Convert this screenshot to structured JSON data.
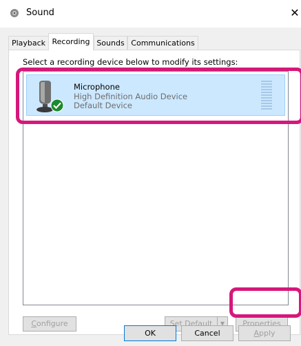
{
  "window": {
    "title": "Sound",
    "close_glyph": "✕"
  },
  "tabs": [
    {
      "label": "Playback",
      "active": false
    },
    {
      "label": "Recording",
      "active": true
    },
    {
      "label": "Sounds",
      "active": false
    },
    {
      "label": "Communications",
      "active": false
    }
  ],
  "recording": {
    "instruction": "Select a recording device below to modify its settings:",
    "devices": [
      {
        "name": "Microphone",
        "description": "High Definition Audio Device",
        "status": "Default Device",
        "icon": "microphone-icon",
        "status_icon": "default-device-check-icon",
        "selected": true
      }
    ]
  },
  "buttons": {
    "configure": {
      "prefix": "",
      "mnemonic": "C",
      "rest": "onfigure",
      "enabled": false
    },
    "set_default": {
      "prefix": "",
      "mnemonic": "S",
      "rest": "et Default",
      "enabled": false
    },
    "properties": {
      "prefix": "",
      "mnemonic": "P",
      "rest": "roperties",
      "enabled": false
    }
  },
  "dialog_buttons": {
    "ok": "OK",
    "cancel": "Cancel",
    "apply": {
      "mnemonic": "A",
      "rest": "pply",
      "enabled": false
    }
  },
  "colors": {
    "selection_bg": "#cce8ff",
    "annotation": "#d6177a",
    "check_green": "#1b8a2f"
  }
}
